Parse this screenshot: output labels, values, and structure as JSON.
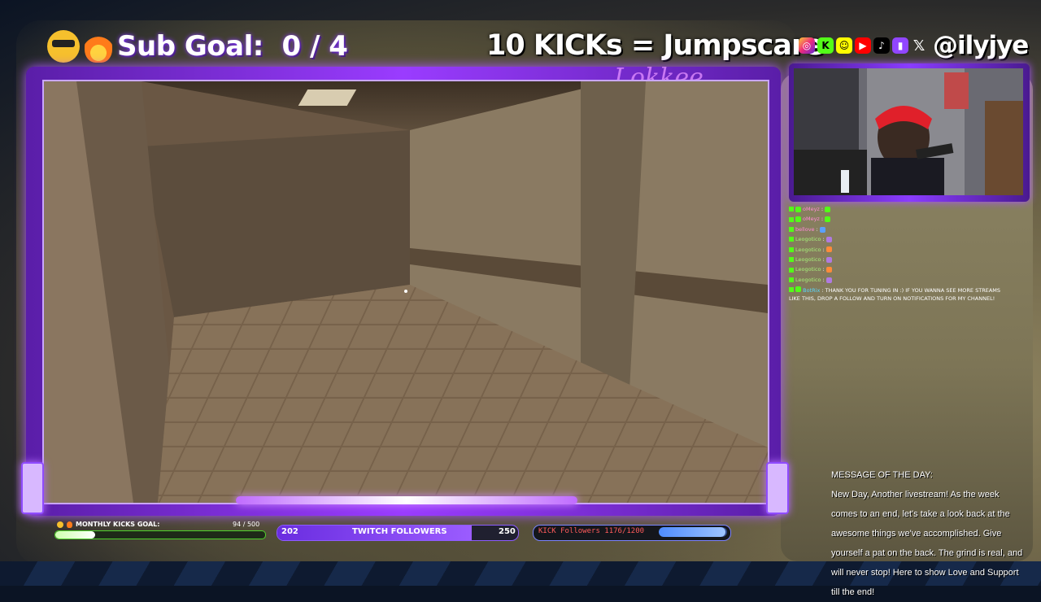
{
  "header": {
    "sub_goal": "Sub Goal:  0 / 4",
    "kicks_jumpscare": "10 KICKs = Jumpscare",
    "handle": "@ilyjye",
    "social_icons": [
      "instagram-icon",
      "kick-icon",
      "snapchat-icon",
      "youtube-icon",
      "tiktok-icon",
      "twitch-icon",
      "x-icon"
    ]
  },
  "game": {
    "logo_text": "Lokkee"
  },
  "chat": {
    "messages": [
      {
        "user": "oMeyz",
        "sep": ":",
        "style": "pink"
      },
      {
        "user": "oMeyz",
        "sep": ":",
        "style": "pink"
      },
      {
        "user": "bellove",
        "sep": ":",
        "style": "pink"
      },
      {
        "user": "Leogotico",
        "sep": ":",
        "style": "normal"
      },
      {
        "user": "Leogotico",
        "sep": ":",
        "style": "normal"
      },
      {
        "user": "Leogotico",
        "sep": ":",
        "style": "normal"
      },
      {
        "user": "Leogotico",
        "sep": ":",
        "style": "normal"
      },
      {
        "user": "Leogotico",
        "sep": ":",
        "style": "normal"
      }
    ],
    "bot": {
      "user": "BotRix",
      "message": ": THANK YOU FOR TUNING IN :) IF YOU WANNA SEE MORE STREAMS LIKE THIS, DROP A FOLLOW AND TURN ON NOTIFICATIONS FOR MY CHANNEL!"
    }
  },
  "motd": {
    "title": "MESSAGE OF THE DAY:",
    "body": "New Day, Another livestream! As the week comes to an end, let's take a look back at the awesome things we've accomplished. Give yourself a pat on the back. The grind is real, and will never stop! Here to show Love and Support till the end!"
  },
  "bottom": {
    "kicks_goal_label": "MONTHLY KICKS GOAL:",
    "kicks_goal_count": "94 / 500",
    "kicks_goal_fraction": 0.188,
    "twitch_current": "202",
    "twitch_label": "TWITCH FOLLOWERS",
    "twitch_goal": "250",
    "twitch_fraction": 0.808,
    "kick_followers_label": "KICK Followers 1176/1200",
    "kick_followers_fraction": 0.98
  },
  "colors": {
    "neon_purple": "#a855ff",
    "kick_green": "#53fc18",
    "twitch_purple": "#9b5cff"
  }
}
